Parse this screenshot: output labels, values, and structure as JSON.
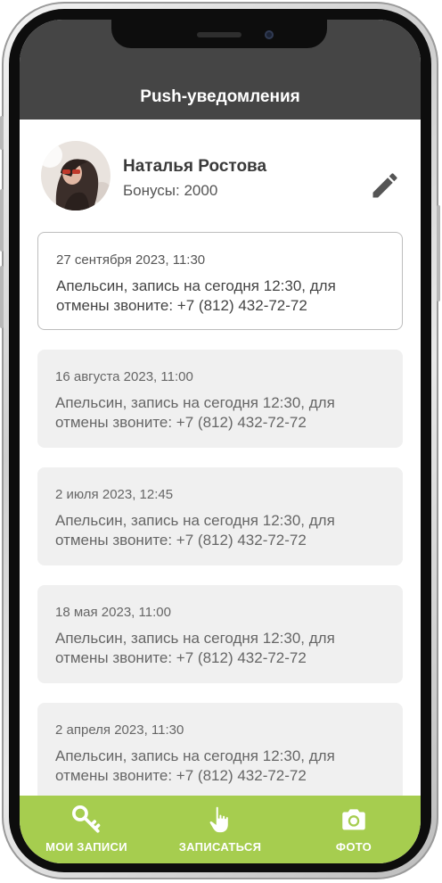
{
  "header": {
    "title": "Push-уведомления"
  },
  "profile": {
    "name": "Наталья Ростова",
    "bonus_text": "Бонусы: 2000",
    "avatar_icon": "user-photo",
    "edit_icon": "pencil-icon"
  },
  "notifications": [
    {
      "date": "27 сентября 2023, 11:30",
      "text": "Апельсин, запись на сегодня 12:30, для отмены звоните: +7 (812) 432-72-72"
    },
    {
      "date": "16 августа 2023, 11:00",
      "text": "Апельсин, запись на сегодня 12:30, для отмены звоните: +7 (812) 432-72-72"
    },
    {
      "date": "2 июля 2023, 12:45",
      "text": "Апельсин, запись на сегодня 12:30, для отмены звоните: +7 (812) 432-72-72"
    },
    {
      "date": "18 мая 2023, 11:00",
      "text": "Апельсин, запись на сегодня 12:30, для отмены звоните: +7 (812) 432-72-72"
    },
    {
      "date": "2 апреля 2023, 11:30",
      "text": "Апельсин, запись на сегодня 12:30, для отмены звоните: +7 (812) 432-72-72"
    }
  ],
  "tabbar": {
    "items": [
      {
        "label": "МОИ ЗАПИСИ",
        "icon": "key-icon"
      },
      {
        "label": "ЗАПИСАТЬСЯ",
        "icon": "pointing-hand-icon"
      },
      {
        "label": "ФОТО",
        "icon": "camera-icon"
      }
    ]
  },
  "colors": {
    "header": "#454545",
    "accent": "#a6cd4f",
    "card_read": "#f0f0f0",
    "card_border": "#bdbdbd"
  }
}
